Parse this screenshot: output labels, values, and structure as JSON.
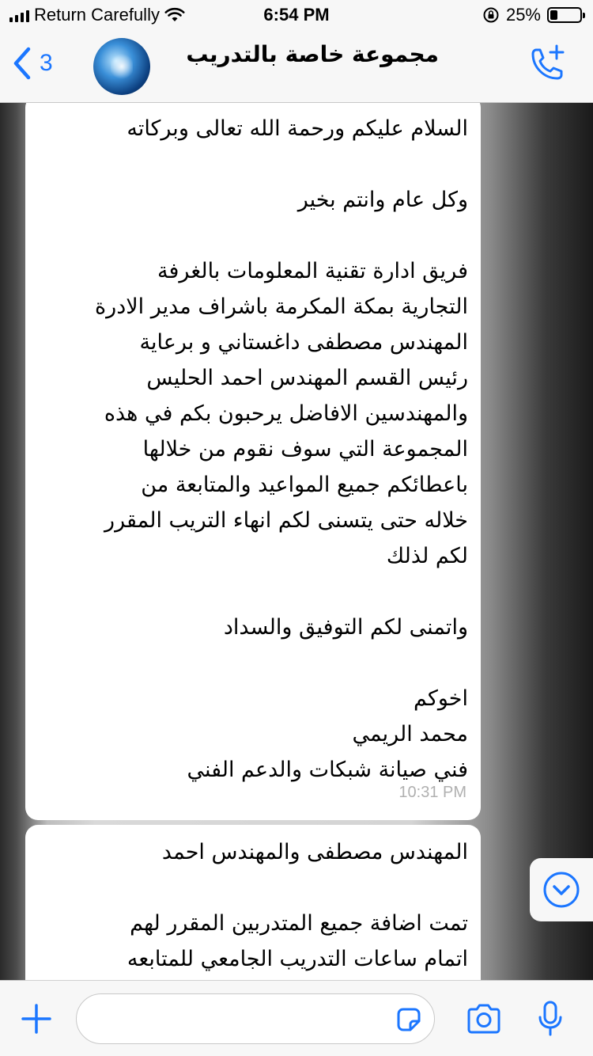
{
  "status_bar": {
    "carrier": "Return Carefully",
    "time": "6:54 PM",
    "battery": "25%",
    "battery_level": 0.25
  },
  "nav": {
    "back_count": "3",
    "group_name": "مجموعة خاصة بالتدريب",
    "back_icon": "chevron-left-icon",
    "call_icon": "phone-plus-icon"
  },
  "messages": [
    {
      "lines": [
        "السلام عليكم ورحمة الله تعالى وبركاته",
        "",
        "وكل عام وانتم بخير",
        "",
        "فريق ادارة تقنية المعلومات بالغرفة",
        "التجارية بمكة المكرمة باشراف مدير الادرة",
        "المهندس مصطفى داغستاني و برعاية",
        "رئيس القسم المهندس احمد الحليس",
        "والمهندسين الافاضل يرحبون بكم في هذه",
        "المجموعة التي سوف نقوم من خلالها",
        "باعطائكم جميع المواعيد والمتابعة من",
        "خلاله حتى يتسنى لكم انهاء التريب المقرر",
        "لكم لذلك",
        "",
        "واتمنى لكم التوفيق والسداد",
        "",
        "اخوكم",
        "محمد الريمي",
        "فني صيانة شبكات والدعم الفني"
      ],
      "time": "10:31 PM"
    },
    {
      "lines": [
        "المهندس مصطفى والمهندس احمد",
        "",
        "تمت اضافة جميع المتدربين المقرر لهم",
        "اتمام ساعات التدريب الجامعي للمتابعه"
      ]
    }
  ],
  "input": {
    "placeholder": ""
  },
  "colors": {
    "accent": "#1b76ff",
    "bar_bg": "#f7f7f7",
    "timestamp": "#b0b0b0"
  }
}
